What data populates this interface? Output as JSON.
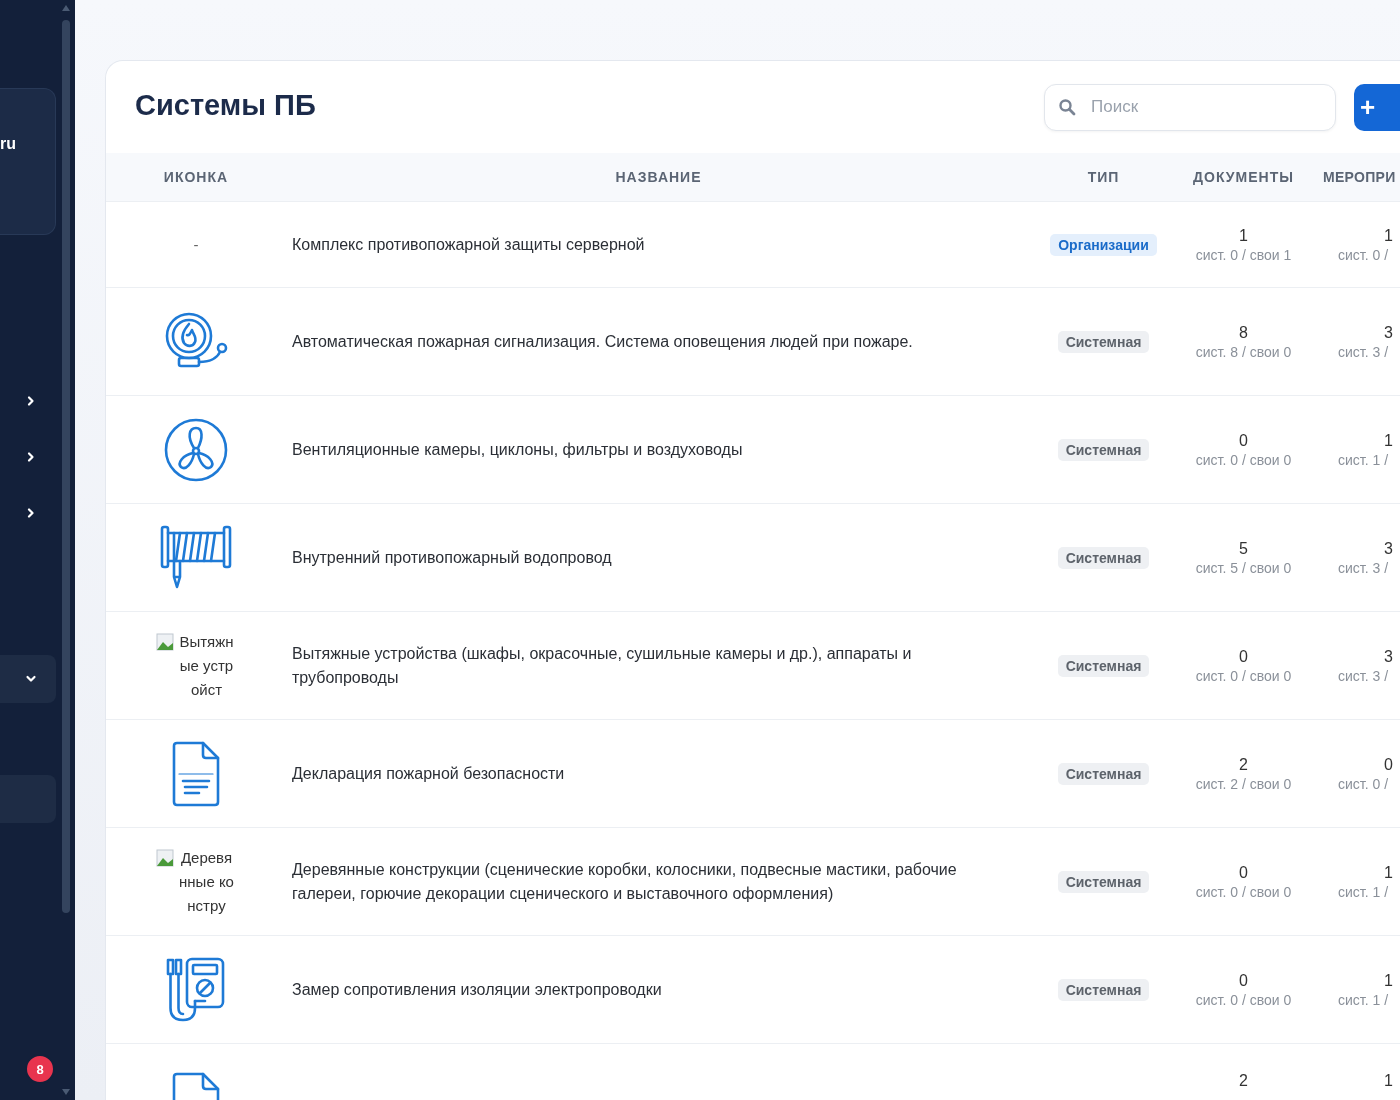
{
  "sidebar": {
    "account_text": "ru",
    "items": [
      {
        "kind": "group",
        "expanded": false
      },
      {
        "kind": "group",
        "expanded": false
      },
      {
        "kind": "group",
        "expanded": false
      },
      {
        "kind": "group",
        "expanded": true
      },
      {
        "kind": "link",
        "selected": true
      }
    ],
    "badge": "8"
  },
  "page": {
    "title": "Системы ПБ",
    "search": {
      "placeholder": "Поиск"
    },
    "add_button": "+"
  },
  "table": {
    "columns": [
      "ИКОНКА",
      "НАЗВАНИЕ",
      "ТИП",
      "ДОКУМЕНТЫ",
      "МЕРОПРИ"
    ],
    "rows": [
      {
        "icon": {
          "kind": "none",
          "text": "-"
        },
        "name": "Комплекс противопожарной защиты серверной",
        "type": {
          "kind": "org",
          "label": "Организации"
        },
        "docs": "1",
        "docs_detail": "сист. 0 / свои 1",
        "events": "1",
        "events_detail": "сист. 0 /"
      },
      {
        "icon": {
          "kind": "bell"
        },
        "name": "Автоматическая пожарная сигнализация. Система оповещения людей при пожаре.",
        "type": {
          "kind": "system",
          "label": "Системная"
        },
        "docs": "8",
        "docs_detail": "сист. 8 / свои 0",
        "events": "3",
        "events_detail": "сист. 3 /"
      },
      {
        "icon": {
          "kind": "fan"
        },
        "name": "Вентиляционные камеры, циклоны, фильтры и воздуховоды",
        "type": {
          "kind": "system",
          "label": "Системная"
        },
        "docs": "0",
        "docs_detail": "сист. 0 / свои 0",
        "events": "1",
        "events_detail": "сист. 1 /"
      },
      {
        "icon": {
          "kind": "hose"
        },
        "name": "Внутренний противопожарный водопровод",
        "type": {
          "kind": "system",
          "label": "Системная"
        },
        "docs": "5",
        "docs_detail": "сист. 5 / свои 0",
        "events": "3",
        "events_detail": "сист. 3 /"
      },
      {
        "icon": {
          "kind": "broken",
          "text": "Вытяжные устройст"
        },
        "name": "Вытяжные устройства (шкафы, окрасочные, сушильные камеры и др.), аппараты и трубопроводы",
        "type": {
          "kind": "system",
          "label": "Системная"
        },
        "docs": "0",
        "docs_detail": "сист. 0 / свои 0",
        "events": "3",
        "events_detail": "сист. 3 /"
      },
      {
        "icon": {
          "kind": "document"
        },
        "name": "Декларация пожарной безопасности",
        "type": {
          "kind": "system",
          "label": "Системная"
        },
        "docs": "2",
        "docs_detail": "сист. 2 / свои 0",
        "events": "0",
        "events_detail": "сист. 0 /"
      },
      {
        "icon": {
          "kind": "broken",
          "text": "Деревянные констру"
        },
        "name": "Деревянные конструкции (сценические коробки, колосники, подвесные мастики, рабочие галереи, горючие декорации сценического и выставочного оформления)",
        "type": {
          "kind": "system",
          "label": "Системная"
        },
        "docs": "0",
        "docs_detail": "сист. 0 / свои 0",
        "events": "1",
        "events_detail": "сист. 1 /"
      },
      {
        "icon": {
          "kind": "meter"
        },
        "name": "Замер сопротивления изоляции электропроводки",
        "type": {
          "kind": "system",
          "label": "Системная"
        },
        "docs": "0",
        "docs_detail": "сист. 0 / свои 0",
        "events": "1",
        "events_detail": "сист. 1 /"
      },
      {
        "icon": {
          "kind": "document"
        },
        "docs": "2",
        "events": "1"
      }
    ]
  }
}
